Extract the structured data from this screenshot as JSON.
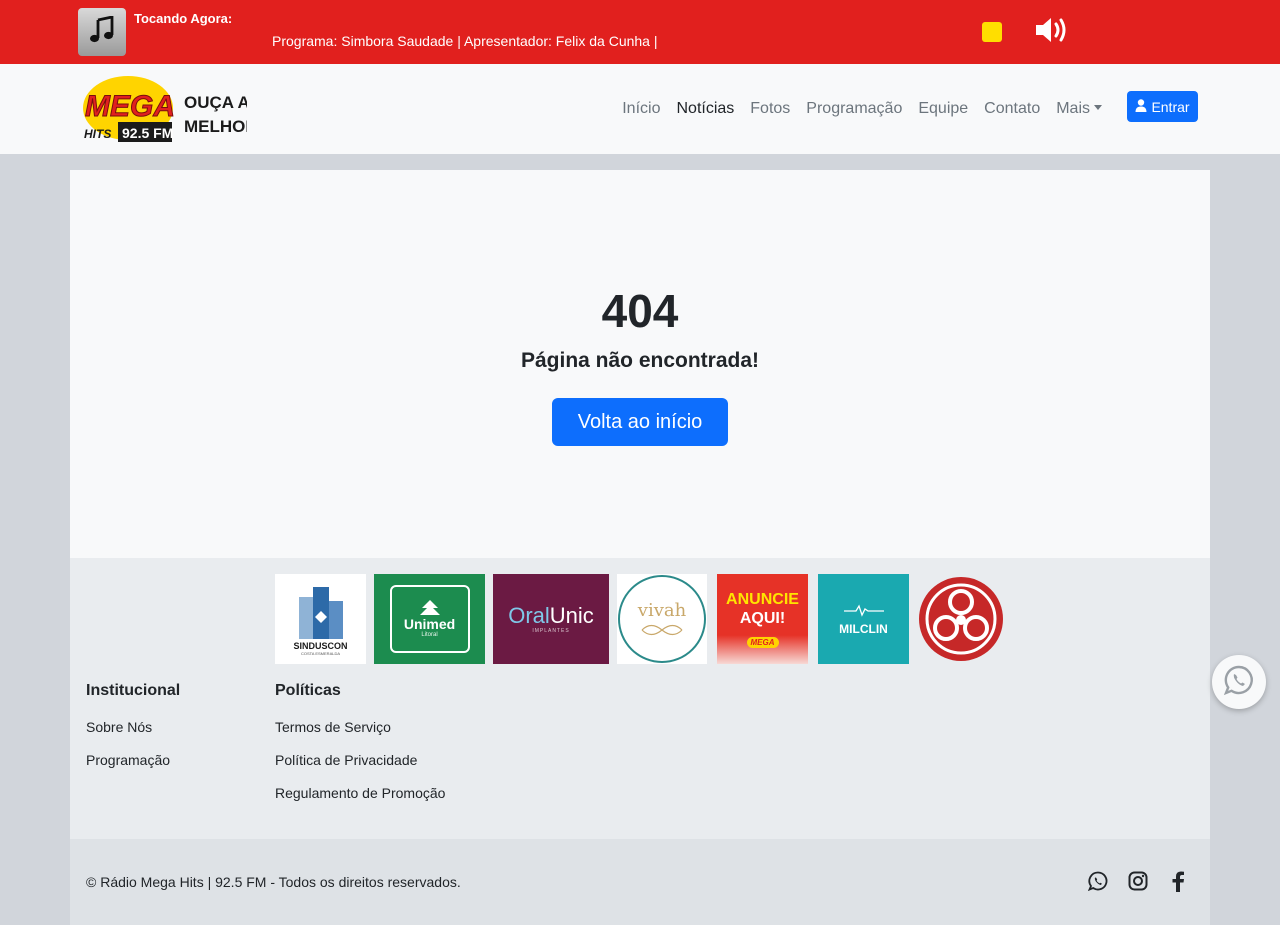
{
  "player": {
    "now_playing_label": "Tocando Agora:",
    "marquee": "Programa: Simbora Saudade | Apresentador: Felix da Cunha |",
    "cover_icon": "music-note-icon",
    "stop_icon": "stop-icon",
    "volume_icon": "volume-up-icon",
    "bar_color": "#e1201e",
    "stop_color": "#ffde00"
  },
  "brand": {
    "logo_word": "MEGA",
    "logo_sub": "HITS",
    "logo_freq": "92.5 FM",
    "tagline_1": "OUÇA A",
    "tagline_2": "MELHOR!"
  },
  "nav": {
    "items": [
      {
        "label": "Início"
      },
      {
        "label": "Notícias"
      },
      {
        "label": "Fotos"
      },
      {
        "label": "Programação"
      },
      {
        "label": "Equipe"
      },
      {
        "label": "Contato"
      },
      {
        "label": "Mais"
      }
    ],
    "active": "Notícias",
    "login_label": "Entrar",
    "accent": "#0d6efd"
  },
  "error": {
    "code": "404",
    "message": "Página não encontrada!",
    "button_label": "Volta ao início"
  },
  "sponsors": {
    "sinduscon": {
      "name": "SINDUSCON",
      "sub": "COSTA ESMERALDA"
    },
    "unimed": {
      "name": "Unimed",
      "sub": "Litoral"
    },
    "oral": {
      "name_a": "Oral",
      "name_b": "Unic",
      "sub": "IMPLANTES"
    },
    "vivah": {
      "name": "vivah"
    },
    "anuncie": {
      "line1": "ANUNCIE",
      "line2": "AQUI!",
      "badge": "MEGA"
    },
    "milclin": {
      "name": "MILCLIN"
    }
  },
  "footer": {
    "institucional": {
      "title": "Institucional",
      "links": [
        {
          "label": "Sobre Nós"
        },
        {
          "label": "Programação"
        }
      ]
    },
    "politicas": {
      "title": "Políticas",
      "links": [
        {
          "label": "Termos de Serviço"
        },
        {
          "label": "Política de Privacidade"
        },
        {
          "label": "Regulamento de Promoção"
        }
      ]
    },
    "copyright": "© Rádio Mega Hits | 92.5 FM - Todos os direitos reservados.",
    "social_icons": [
      "whatsapp-icon",
      "instagram-icon",
      "facebook-icon"
    ]
  }
}
